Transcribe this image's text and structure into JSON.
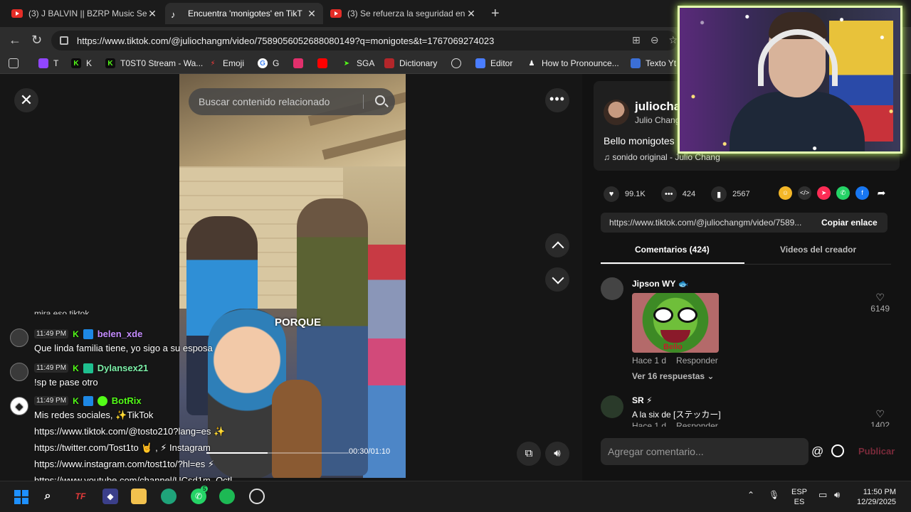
{
  "browser": {
    "tabs": [
      {
        "title": "(3) J BALVIN || BZRP Music Session",
        "icon": "youtube-icon",
        "active": false
      },
      {
        "title": "Encuentra 'monigotes' en TikT",
        "icon": "tiktok-icon",
        "active": true
      },
      {
        "title": "(3) Se refuerza la seguridad en la c",
        "icon": "youtube-icon",
        "active": false
      }
    ],
    "url": "https://www.tiktok.com/@juliochangm/video/7589056052688080149?q=monigotes&t=1767069274023",
    "bookmarks": [
      "T",
      "K",
      "T0ST0 Stream - Wa...",
      "Emoji",
      "G",
      "",
      "",
      "SGA",
      "Dictionary",
      "",
      "Editor",
      "How to Pronounce...",
      "Texto Yt"
    ]
  },
  "video": {
    "search_placeholder": "Buscar contenido relacionado",
    "caption_word": "PORQUE",
    "time": "00:30/01:10",
    "progress": 0.43
  },
  "chat": {
    "cut_text": "mira eso tiktok",
    "messages": [
      {
        "time": "11:49 PM",
        "user": "belen_xde",
        "user_color": "#c58cff",
        "text": "Que linda familia tiene, yo sigo a su esposa"
      },
      {
        "time": "11:49 PM",
        "user": "Dylansex21",
        "user_color": "#7cf0a8",
        "text": "!sp te pase otro"
      },
      {
        "time": "11:49 PM",
        "user": "BotRix",
        "user_color": "#53fc18",
        "text": "Mis redes sociales, ✨TikTok"
      }
    ],
    "links": [
      "https://www.tiktok.com/@tosto210?lang=es ✨",
      "https://twitter.com/Tost1to 🤘 , ⚡ Instagram",
      "https://www.instagram.com/tost1to/?hl=es ⚡",
      "https://www.youtube.com/channel/UCsd1m_Octl"
    ]
  },
  "panel": {
    "username": "juliocha",
    "display_name": "Julio Chang",
    "description": "Bello monigotes",
    "music": "♫ sonido original - Julio Chang",
    "likes": "99.1K",
    "comments": "424",
    "saves": "2567",
    "link": "https://www.tiktok.com/@juliochangm/video/7589...",
    "copy_label": "Copiar enlace",
    "tab_comments": "Comentarios (424)",
    "tab_creator": "Videos del creador",
    "comment_list": [
      {
        "user": "Jipson WY 🐟",
        "sticker_text": "Bello",
        "age": "Hace 1 d",
        "reply": "Responder",
        "replies": "Ver 16 respuestas ⌄",
        "likes": "6149"
      },
      {
        "user": "SR ⚡",
        "text": "A la six de [ステッカー]",
        "age": "Hace 1 d",
        "reply": "Responder",
        "likes": "1402"
      }
    ],
    "add_comment_placeholder": "Agregar comentario...",
    "at_symbol": "@",
    "publish_label": "Publicar"
  },
  "taskbar": {
    "lang": "ESP",
    "lang2": "ES",
    "time": "11:50 PM",
    "date": "12/29/2025",
    "whatsapp_badge": "5"
  }
}
